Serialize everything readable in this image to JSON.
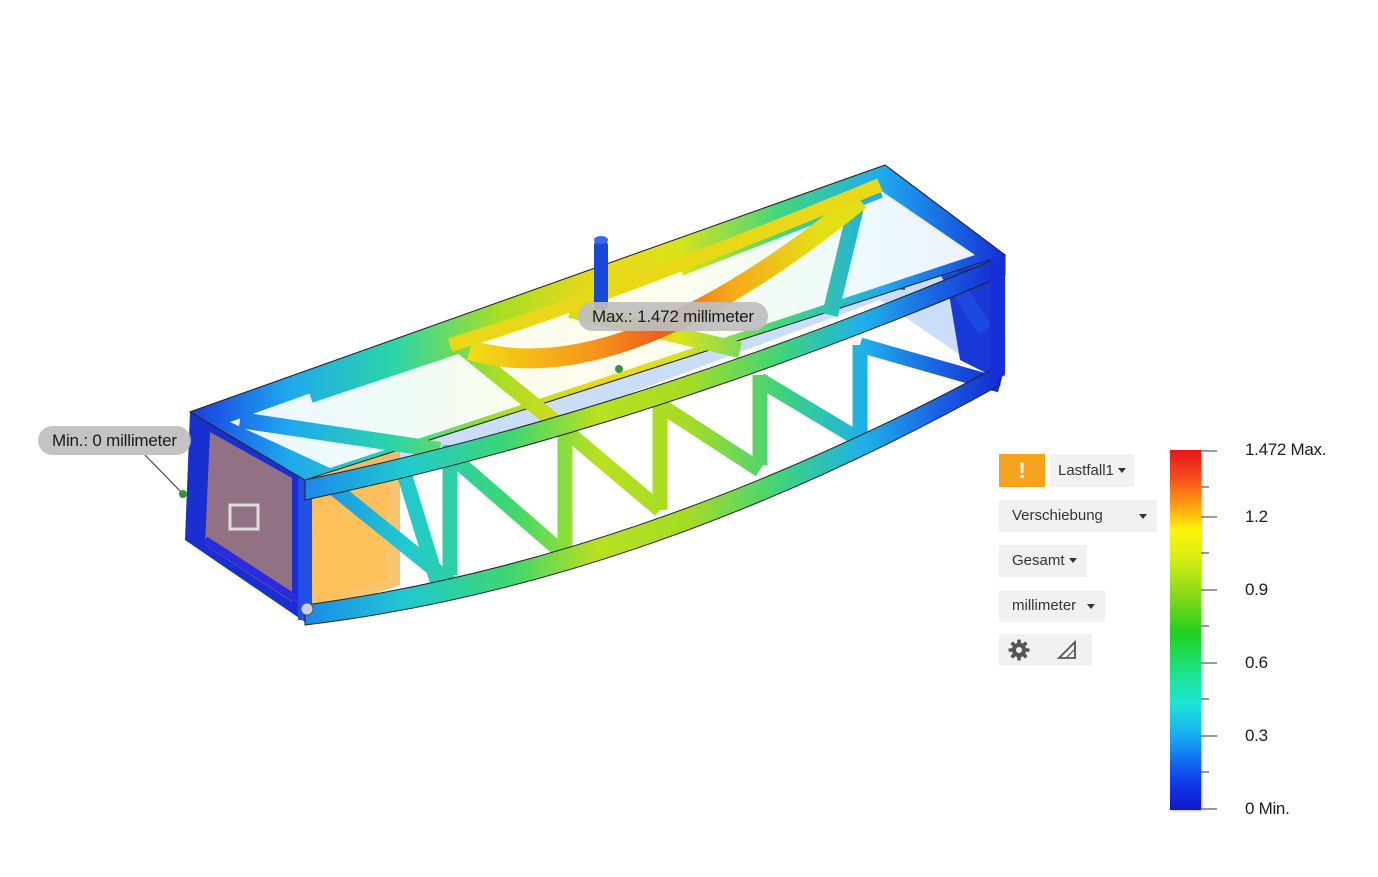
{
  "probes": {
    "min_label": "Min.: 0 millimeter",
    "max_label": "Max.: 1.472 millimeter"
  },
  "panel": {
    "warning_icon": "!",
    "load_case": "Lastfall1",
    "result_type": "Verschiebung",
    "component": "Gesamt",
    "unit": "millimeter",
    "settings_icon": "gear-icon",
    "probe_icon": "probe-icon"
  },
  "legend": {
    "labels": [
      "1.472 Max.",
      "1.2",
      "0.9",
      "0.6",
      "0.3",
      "0 Min."
    ],
    "min": 0,
    "max": 1.472,
    "colors": {
      "max": "#e8141c",
      "high": "#fff30a",
      "mid": "#1fd01e",
      "low": "#1ce6d2",
      "min": "#1018d0"
    }
  },
  "colors": {
    "accent_warning": "#f5a21d",
    "panel_bg": "#f1f1f1",
    "callout_bg": "#bebebe"
  }
}
